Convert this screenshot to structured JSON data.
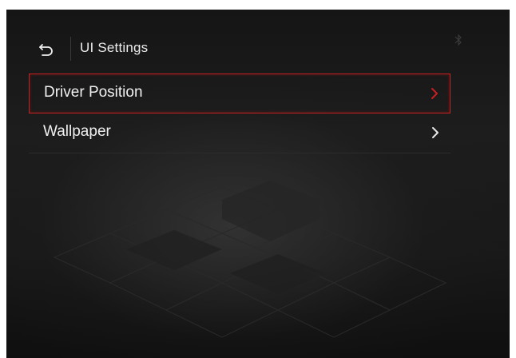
{
  "header": {
    "title": "UI Settings",
    "back_icon": "back-arrow-icon",
    "status_icon": "bluetooth-icon"
  },
  "menu": {
    "items": [
      {
        "label": "Driver Position",
        "selected": true,
        "icon": "chevron-right-icon"
      },
      {
        "label": "Wallpaper",
        "selected": false,
        "icon": "chevron-right-icon"
      }
    ]
  },
  "colors": {
    "accent": "#c62020",
    "text": "#f0f0f0",
    "background": "#1a1a1a"
  }
}
